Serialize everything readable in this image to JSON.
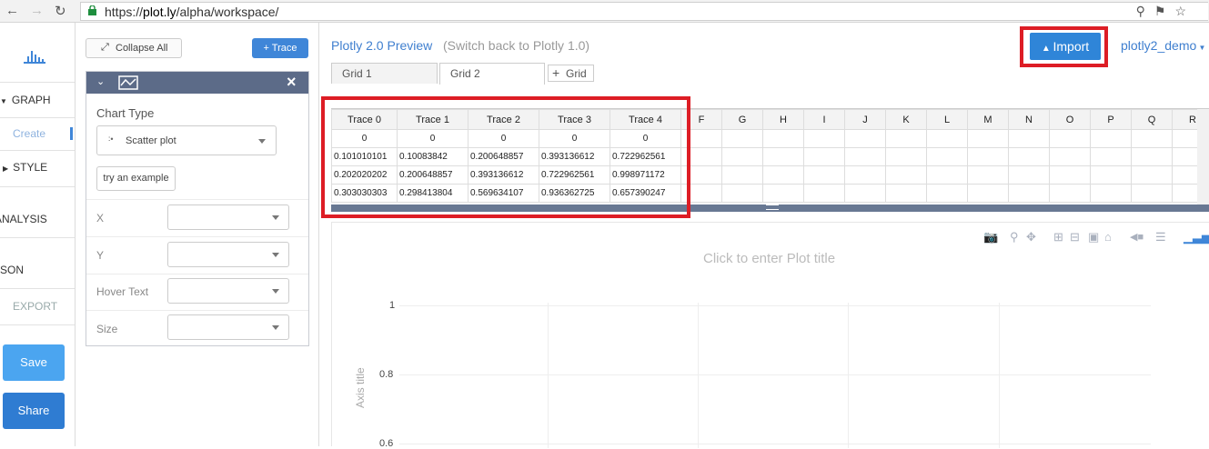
{
  "browser": {
    "url_prefix": "https://",
    "url_domain": "plot.ly",
    "url_path": "/alpha/workspace/"
  },
  "leftnav": {
    "graph": "GRAPH",
    "create": "Create",
    "style": "STYLE",
    "analysis": "ANALYSIS",
    "json": "SON",
    "export": "EXPORT",
    "save": "Save",
    "share": "Share"
  },
  "panel": {
    "collapse_all": "Collapse All",
    "add_trace": "+ Trace",
    "chart_type_label": "Chart Type",
    "chart_type_value": "Scatter plot",
    "try_example": "try an example",
    "fields": [
      "X",
      "Y",
      "Hover Text",
      "Size"
    ]
  },
  "header": {
    "title": "Plotly 2.0 Preview",
    "switch_back": "(Switch back to Plotly 1.0)",
    "import": "Import",
    "user": "plotly2_demo"
  },
  "tabs": [
    "Grid 1",
    "Grid 2",
    "Grid"
  ],
  "grid": {
    "columns": [
      "Trace 0",
      "Trace 1",
      "Trace 2",
      "Trace 3",
      "Trace 4",
      "F",
      "G",
      "H",
      "I",
      "J",
      "K",
      "L",
      "M",
      "N",
      "O",
      "P",
      "Q",
      "R"
    ],
    "rows": [
      [
        "0",
        "0",
        "0",
        "0",
        "0"
      ],
      [
        "0.101010101",
        "0.10083842",
        "0.200648857",
        "0.393136612",
        "0.722962561"
      ],
      [
        "0.202020202",
        "0.200648857",
        "0.393136612",
        "0.722962561",
        "0.998971172"
      ],
      [
        "0.303030303",
        "0.298413804",
        "0.569634107",
        "0.936362725",
        "0.657390247"
      ]
    ]
  },
  "plot": {
    "title_placeholder": "Click to enter Plot title",
    "y_ticks": [
      "1",
      "0.8",
      "0.6"
    ],
    "y_axis_title": "Axis title"
  },
  "colors": {
    "accent": "#3f86d8",
    "highlight": "#dd1d25",
    "panel_header": "#5c6b88"
  }
}
